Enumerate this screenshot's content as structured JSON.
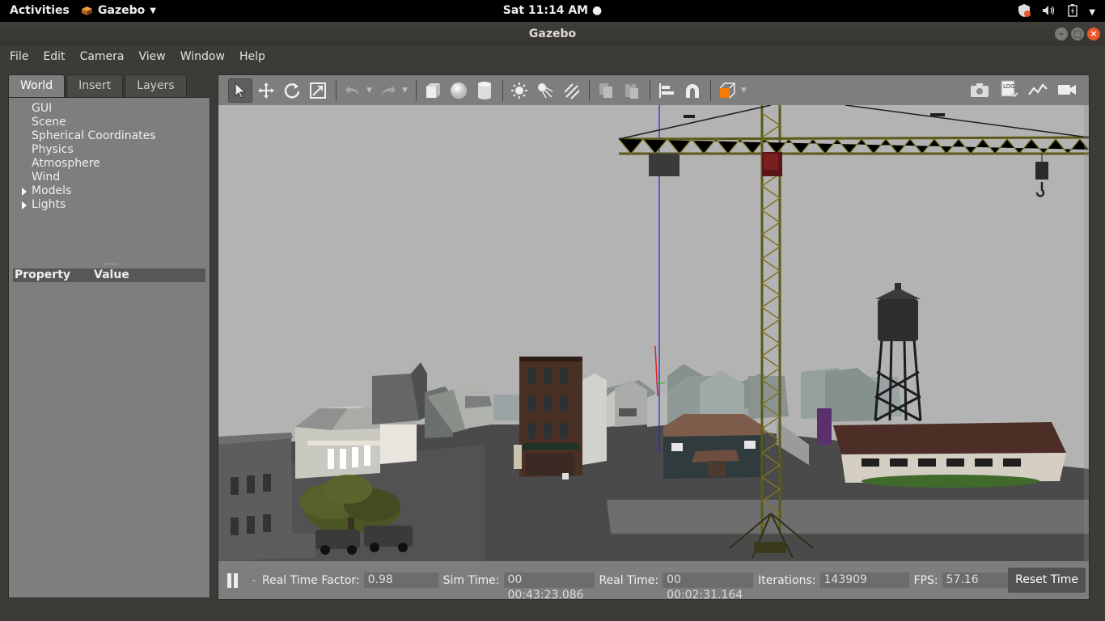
{
  "topbar": {
    "activities": "Activities",
    "app_name": "Gazebo",
    "clock": "Sat 11:14 AM"
  },
  "window": {
    "title": "Gazebo"
  },
  "menubar": {
    "items": [
      "File",
      "Edit",
      "Camera",
      "View",
      "Window",
      "Help"
    ]
  },
  "left_panel": {
    "tabs": [
      "World",
      "Insert",
      "Layers"
    ],
    "active_tab": "World",
    "tree": [
      "GUI",
      "Scene",
      "Spherical Coordinates",
      "Physics",
      "Atmosphere",
      "Wind",
      "Models",
      "Lights"
    ],
    "expandable": [
      "Models",
      "Lights"
    ],
    "property_header": {
      "property": "Property",
      "value": "Value"
    }
  },
  "toolbar": {
    "tools": [
      "select-mode",
      "translate-mode",
      "rotate-mode",
      "scale-mode",
      "undo",
      "redo",
      "box",
      "sphere",
      "cylinder",
      "point-light",
      "spot-light",
      "directional-light",
      "copy",
      "paste",
      "align",
      "snap",
      "change-view"
    ],
    "right_tools": [
      "screenshot",
      "log",
      "plot",
      "record-video"
    ],
    "log_label": "LOG"
  },
  "bottombar": {
    "rtf_label": "Real Time Factor:",
    "rtf": "0.98",
    "sim_label": "Sim Time:",
    "sim_time": "00 00:43:23.086",
    "real_label": "Real Time:",
    "real_time": "00 00:02:31.164",
    "iter_label": "Iterations:",
    "iterations": "143909",
    "fps_label": "FPS:",
    "fps": "57.16",
    "reset_label": "Reset Time"
  },
  "colors": {
    "panel_gray": "#7e7e7e",
    "window_bg": "#3c3b37",
    "crane_yellow": "#6b6a1f",
    "close_orange": "#e9572a"
  }
}
